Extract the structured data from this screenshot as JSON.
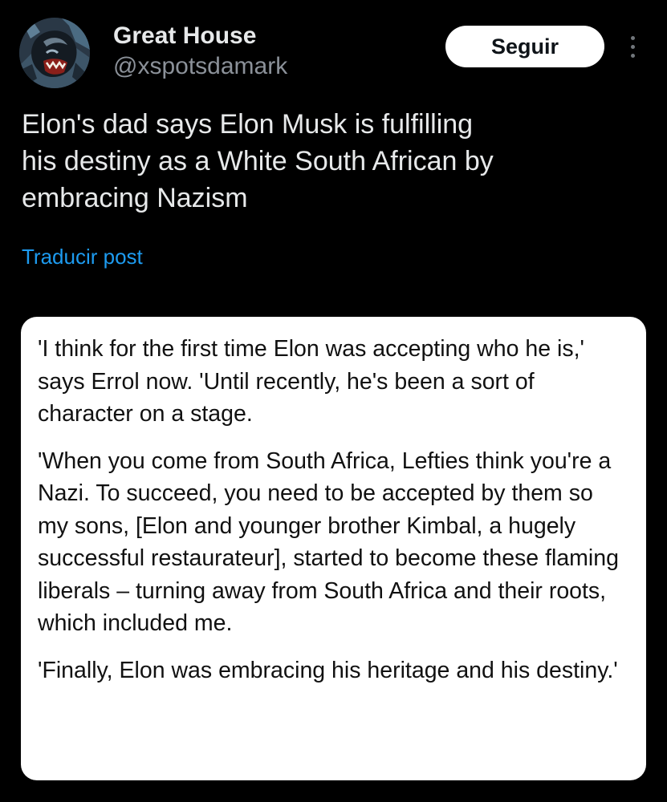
{
  "author": {
    "display_name": "Great House",
    "handle": "@xspotsdamark",
    "avatar_icon": "gorilla-avatar-icon"
  },
  "actions": {
    "follow_label": "Seguir",
    "more_icon": "more-vertical-icon"
  },
  "post": {
    "text": "Elon's dad says Elon Musk is fulfilling\nhis destiny as a White South African by\nembracing Nazism",
    "translate_label": "Traducir post"
  },
  "quote_image": {
    "paragraphs": [
      "'I think for the first time Elon was accepting who he is,' says Errol now. 'Until recently, he's been a sort of character on a stage.",
      "'When you come from South Africa, Lefties think you're a Nazi. To succeed, you need to be accepted by them so my sons, [Elon and younger brother Kimbal, a hugely successful restaurateur], started to become these flaming liberals – turning away from South Africa and their roots, which included me.",
      "'Finally, Elon was embracing his heritage and his destiny.'"
    ]
  },
  "colors": {
    "background": "#000000",
    "text_primary": "#e7e9ea",
    "text_secondary": "#8b9199",
    "link": "#1d9bf0",
    "card_background": "#ffffff",
    "card_text": "#111111"
  }
}
